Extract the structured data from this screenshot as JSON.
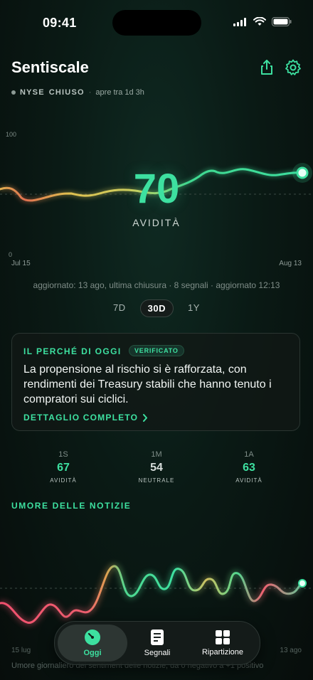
{
  "status_bar": {
    "time": "09:41"
  },
  "header": {
    "title": "Sentiscale"
  },
  "market": {
    "exchange": "NYSE",
    "status": "CHIUSO",
    "opens": "apre tra 1d 3h"
  },
  "chart": {
    "y_max_label": "100",
    "y_min_label": "0",
    "x_start": "Jul 15",
    "x_end": "Aug 13",
    "score": "70",
    "score_label": "AVIDITÀ"
  },
  "updated": "aggiornato: 13 ago, ultima chiusura · 8 segnali · aggiornato 12:13",
  "ranges": [
    "7D",
    "30D",
    "1Y"
  ],
  "active_range": "30D",
  "why_card": {
    "title": "IL PERCHÉ DI OGGI",
    "badge": "VERIFICATO",
    "body": "La propensione al rischio si è rafforzata, con rendimenti dei Treasury stabili che hanno tenuto i compratori sui ciclici.",
    "link": "DETTAGLIO COMPLETO"
  },
  "stats": [
    {
      "period": "1S",
      "value": "67",
      "label": "AVIDITÀ",
      "color": "#3de0a0"
    },
    {
      "period": "1M",
      "value": "54",
      "label": "NEUTRALE",
      "color": "#d6dcda"
    },
    {
      "period": "1A",
      "value": "63",
      "label": "AVIDITÀ",
      "color": "#3de0a0"
    }
  ],
  "news": {
    "title": "UMORE DELLE NOTIZIE",
    "x_start": "15 lug",
    "x_end": "13 ago",
    "footer": "Umore giornaliero dei sentiment delle notizie, da 0 negativo a +1 positivo"
  },
  "tabs": [
    {
      "label": "Oggi",
      "icon": "gauge-icon"
    },
    {
      "label": "Segnali",
      "icon": "document-icon"
    },
    {
      "label": "Ripartizione",
      "icon": "grid-icon"
    }
  ],
  "colors": {
    "accent": "#3de0a0",
    "negative": "#f0506e",
    "warning": "#f0a040"
  }
}
